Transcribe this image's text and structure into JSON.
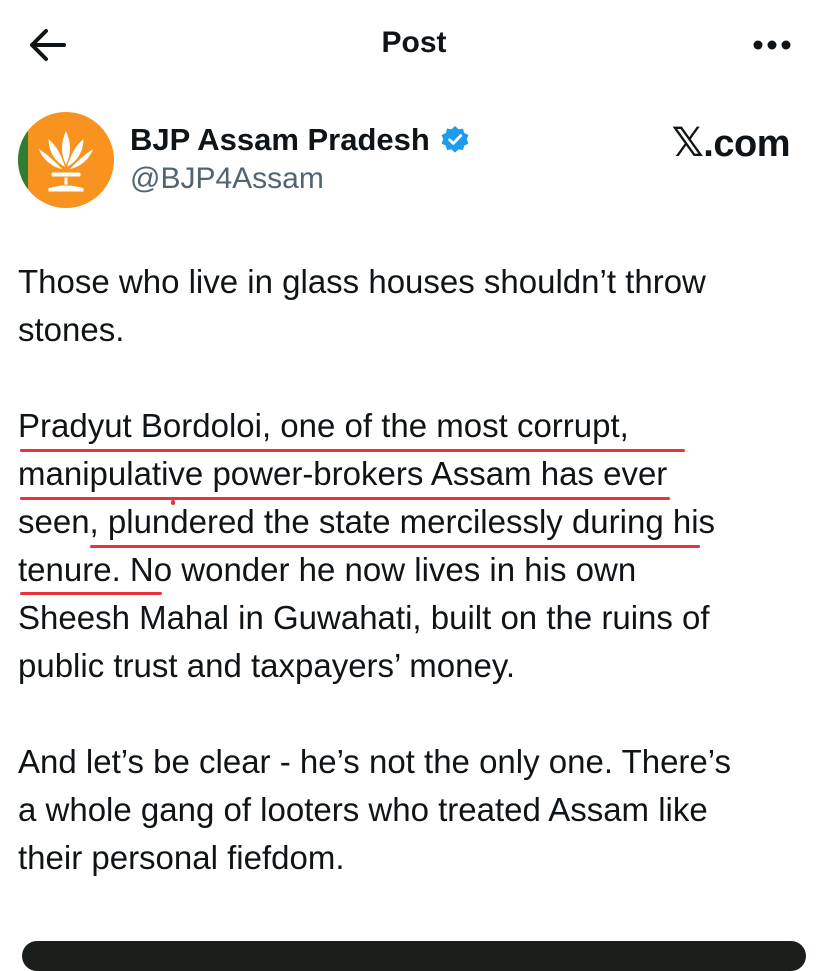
{
  "header": {
    "title": "Post",
    "back_icon": "arrow-left-icon",
    "more_icon": "more-horizontal-icon"
  },
  "author": {
    "name": "BJP Assam Pradesh",
    "handle": "@BJP4Assam",
    "verified": true,
    "avatar_color": "#f7931e"
  },
  "watermark": {
    "glyph": "𝕏",
    "text": ".com"
  },
  "post": {
    "paragraphs": [
      "Those who live in glass houses shouldn’t throw\nstones.",
      "Pradyut Bordoloi, one of the most corrupt,\nmanipulative power-brokers Assam has ever\nseen, plundered the state mercilessly during his\ntenure. No wonder he now lives in his own\nSheesh Mahal in Guwahati, built on the ruins of\npublic trust and taxpayers’ money.",
      "And let’s be clear - he’s not the only one. There’s\na whole gang of looters who treated Assam like\ntheir personal fiefdom."
    ]
  },
  "colors": {
    "text": "#0f1419",
    "secondary": "#536471",
    "verified": "#1d9bf0",
    "underline": "#e8323a"
  }
}
